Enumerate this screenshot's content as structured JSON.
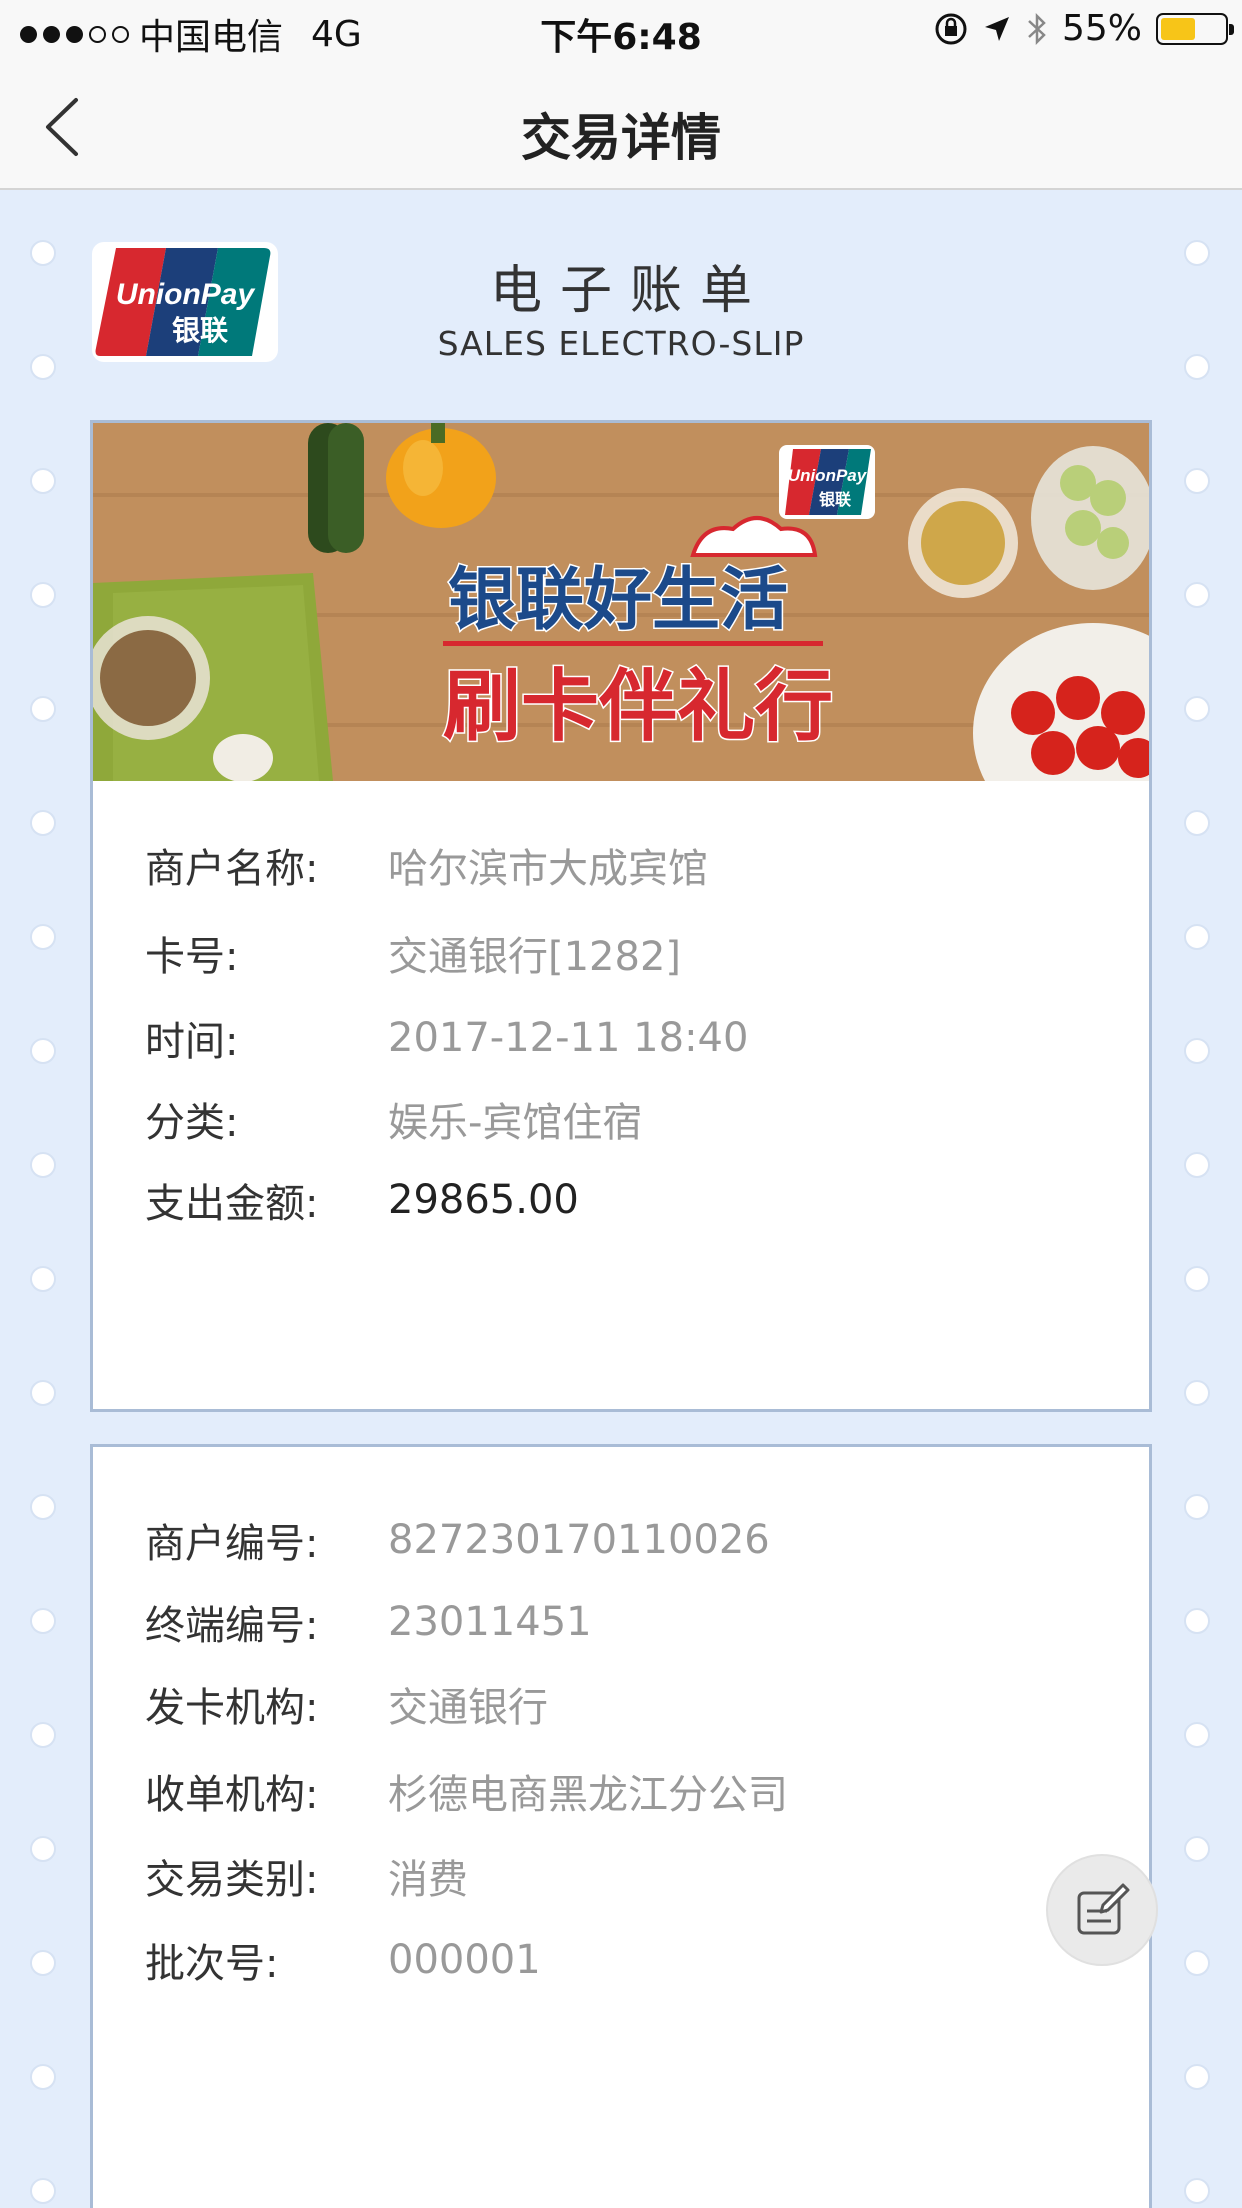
{
  "status_bar": {
    "carrier": "中国电信",
    "network": "4G",
    "time": "下午6:48",
    "battery_percent": "55%",
    "battery_level": 0.55,
    "battery_color": "#f7c518"
  },
  "nav": {
    "title": "交易详情",
    "back_icon": "chevron-left-icon"
  },
  "header": {
    "logo_icon": "unionpay-logo",
    "logo_text_en": "UnionPay",
    "logo_text_cn": "银联",
    "title": "电子账单",
    "subtitle": "SALES ELECTRO-SLIP"
  },
  "banner": {
    "logo_text_en": "UnionPay",
    "logo_text_cn": "银联",
    "line1": "银联好生活",
    "line2": "刷卡伴礼行"
  },
  "summary": [
    {
      "label": "商户名称:",
      "value": "哈尔滨市大成宾馆"
    },
    {
      "label": "卡号:",
      "value": "交通银行[1282]"
    },
    {
      "label": "时间:",
      "value": "2017-12-11 18:40"
    },
    {
      "label": "分类:",
      "value": "娱乐-宾馆住宿"
    },
    {
      "label": "支出金额:",
      "value": "29865.00"
    }
  ],
  "details": [
    {
      "label": "商户编号:",
      "value": "827230170110026"
    },
    {
      "label": "终端编号:",
      "value": "23011451"
    },
    {
      "label": "发卡机构:",
      "value": "交通银行"
    },
    {
      "label": "收单机构:",
      "value": "杉德电商黑龙江分公司"
    },
    {
      "label": "交易类别:",
      "value": "消费"
    },
    {
      "label": "批次号:",
      "value": "000001"
    }
  ],
  "fab": {
    "icon": "edit-note-icon"
  },
  "colors": {
    "background": "#e3edfb",
    "card_border": "#a9bcd6",
    "unionpay_red": "#d7282f",
    "unionpay_blue": "#1c3f7a",
    "unionpay_teal": "#00797a"
  }
}
